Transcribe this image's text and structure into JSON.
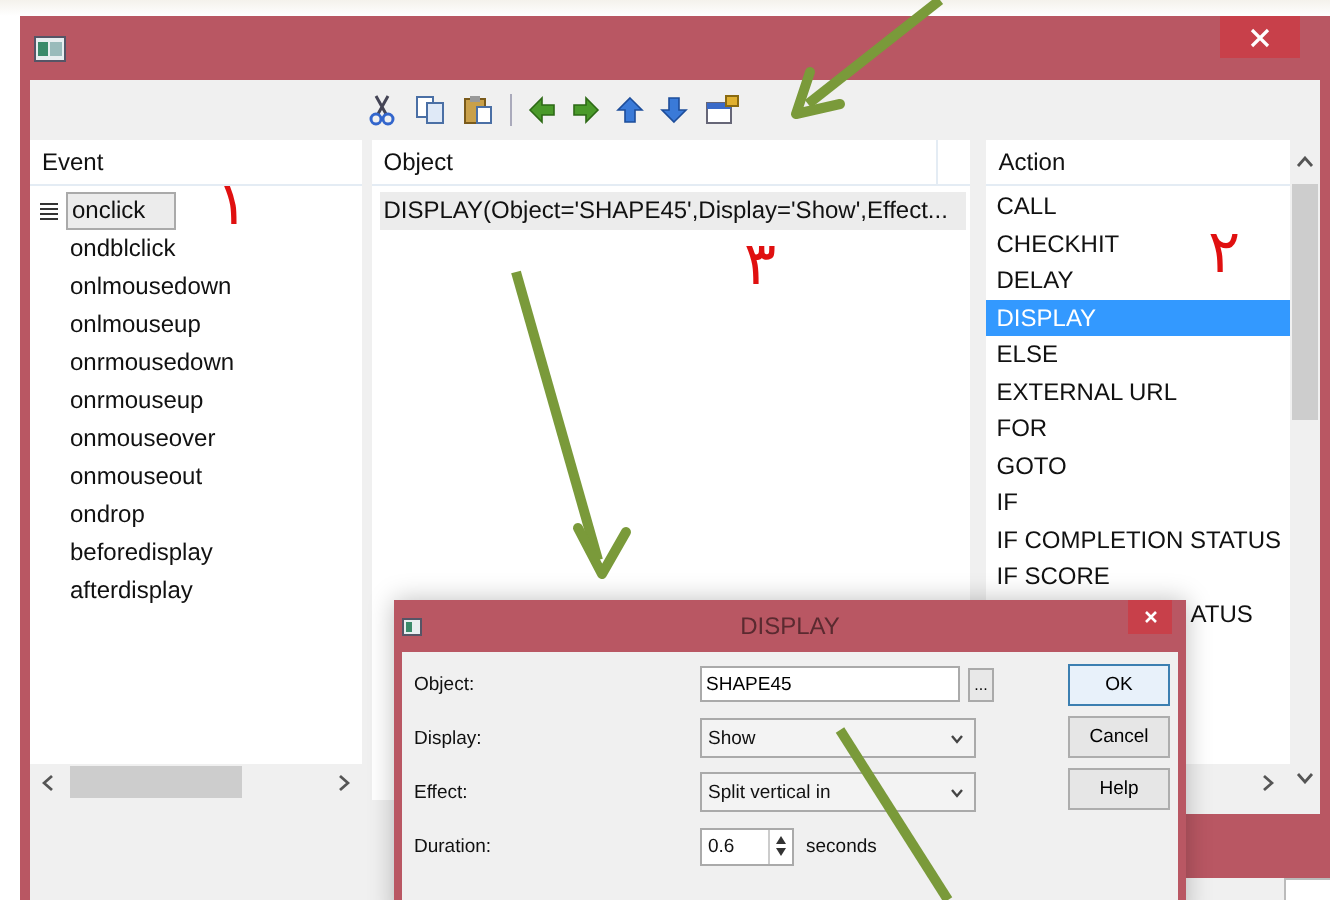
{
  "events": {
    "header": "Event",
    "items": [
      {
        "label": "onclick",
        "selected": true
      },
      {
        "label": "ondblclick",
        "selected": false
      },
      {
        "label": "onlmousedown",
        "selected": false
      },
      {
        "label": "onlmouseup",
        "selected": false
      },
      {
        "label": "onrmousedown",
        "selected": false
      },
      {
        "label": "onrmouseup",
        "selected": false
      },
      {
        "label": "onmouseover",
        "selected": false
      },
      {
        "label": "onmouseout",
        "selected": false
      },
      {
        "label": "ondrop",
        "selected": false
      },
      {
        "label": "beforedisplay",
        "selected": false
      },
      {
        "label": "afterdisplay",
        "selected": false
      }
    ]
  },
  "objects": {
    "header": "Object",
    "rows": [
      {
        "text": "DISPLAY(Object='SHAPE45',Display='Show',Effect...",
        "selected": true
      }
    ]
  },
  "actions": {
    "header": "Action",
    "items": [
      {
        "label": "CALL",
        "selected": false,
        "kind": "full"
      },
      {
        "label": "CHECKHIT",
        "selected": false,
        "kind": "full"
      },
      {
        "label": "DELAY",
        "selected": false,
        "kind": "full"
      },
      {
        "label": "DISPLAY",
        "selected": true,
        "kind": "full"
      },
      {
        "label": "ELSE",
        "selected": false,
        "kind": "full"
      },
      {
        "label": "EXTERNAL URL",
        "selected": false,
        "kind": "full"
      },
      {
        "label": "FOR",
        "selected": false,
        "kind": "full"
      },
      {
        "label": "GOTO",
        "selected": false,
        "kind": "full"
      },
      {
        "label": "IF",
        "selected": false,
        "kind": "full"
      },
      {
        "label": "IF COMPLETION STATUS",
        "selected": false,
        "kind": "full"
      },
      {
        "label": "IF SCORE",
        "selected": false,
        "kind": "full"
      },
      {
        "label": "ATUS",
        "selected": false,
        "kind": "partial"
      }
    ]
  },
  "dialog": {
    "title": "DISPLAY",
    "fields": [
      {
        "label": "Object:",
        "kind": "text",
        "value": "SHAPE45",
        "button": "..."
      },
      {
        "label": "Display:",
        "kind": "select",
        "value": "Show"
      },
      {
        "label": "Effect:",
        "kind": "select",
        "value": "Split vertical in"
      },
      {
        "label": "Duration:",
        "kind": "spin",
        "value": "0.6",
        "unit": "seconds"
      }
    ],
    "buttons": [
      {
        "label": "OK",
        "default": true
      },
      {
        "label": "Cancel",
        "default": false
      },
      {
        "label": "Help",
        "default": false
      }
    ]
  },
  "annotations": [
    {
      "text": "١"
    },
    {
      "text": "٢"
    },
    {
      "text": "٣"
    }
  ]
}
